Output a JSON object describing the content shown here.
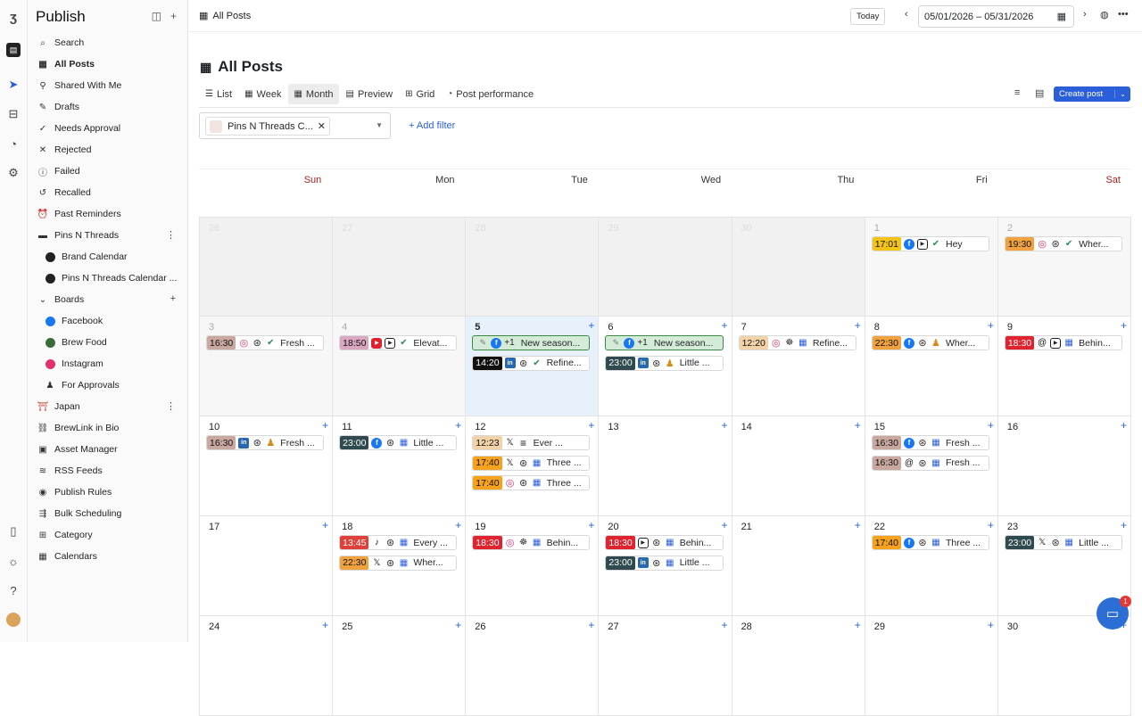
{
  "app": {
    "title": "Publish"
  },
  "crumb": "All Posts",
  "toolbar": {
    "today": "Today",
    "date_range": "05/01/2026  – 05/31/2026",
    "create_post": "Create post"
  },
  "page_title": "All Posts",
  "views": [
    {
      "label": "List"
    },
    {
      "label": "Week"
    },
    {
      "label": "Month"
    },
    {
      "label": "Preview"
    },
    {
      "label": "Grid"
    },
    {
      "label": "Post performance"
    }
  ],
  "filter": {
    "chip": "Pins N Threads C...",
    "add": "Add filter"
  },
  "nav": [
    {
      "label": "Search"
    },
    {
      "label": "All Posts"
    },
    {
      "label": "Shared With Me"
    },
    {
      "label": "Drafts"
    },
    {
      "label": "Needs Approval"
    },
    {
      "label": "Rejected"
    },
    {
      "label": "Failed"
    },
    {
      "label": "Recalled"
    },
    {
      "label": "Past Reminders"
    },
    {
      "label": "Pins N Threads"
    },
    {
      "label": "Brand Calendar"
    },
    {
      "label": "Pins N Threads Calendar ..."
    },
    {
      "label": "Boards"
    },
    {
      "label": "Facebook"
    },
    {
      "label": "Brew Food"
    },
    {
      "label": "Instagram"
    },
    {
      "label": "For Approvals"
    },
    {
      "label": "Japan"
    },
    {
      "label": "BrewLink in Bio"
    },
    {
      "label": "Asset Manager"
    },
    {
      "label": "RSS Feeds"
    },
    {
      "label": "Publish Rules"
    },
    {
      "label": "Bulk Scheduling"
    },
    {
      "label": "Category"
    },
    {
      "label": "Calendars"
    }
  ],
  "days": [
    "Sun",
    "Mon",
    "Tue",
    "Wed",
    "Thu",
    "Fri",
    "Sat"
  ],
  "weeks": [
    [
      {
        "d": "26",
        "out": true
      },
      {
        "d": "27",
        "out": true
      },
      {
        "d": "28",
        "out": true
      },
      {
        "d": "29",
        "out": true
      },
      {
        "d": "30",
        "out": true
      },
      {
        "d": "1",
        "dim": true
      },
      {
        "d": "2",
        "dim": true
      }
    ],
    [
      {
        "d": "3",
        "dim": true
      },
      {
        "d": "4",
        "dim": true
      },
      {
        "d": "5",
        "today": true
      },
      {
        "d": "6"
      },
      {
        "d": "7"
      },
      {
        "d": "8"
      },
      {
        "d": "9"
      }
    ],
    [
      {
        "d": "10"
      },
      {
        "d": "11"
      },
      {
        "d": "12"
      },
      {
        "d": "13"
      },
      {
        "d": "14"
      },
      {
        "d": "15"
      },
      {
        "d": "16"
      }
    ],
    [
      {
        "d": "17"
      },
      {
        "d": "18"
      },
      {
        "d": "19"
      },
      {
        "d": "20"
      },
      {
        "d": "21"
      },
      {
        "d": "22"
      },
      {
        "d": "23"
      }
    ],
    [
      {
        "d": "24"
      },
      {
        "d": "25"
      },
      {
        "d": "26"
      },
      {
        "d": "27"
      },
      {
        "d": "28"
      },
      {
        "d": "29"
      },
      {
        "d": "30"
      }
    ]
  ],
  "posts": {
    "w0_d5": [
      {
        "time": "17:01",
        "text": "Hey"
      }
    ],
    "w0_d6": [
      {
        "time": "19:30",
        "text": "Wher..."
      }
    ],
    "w1_d0": [
      {
        "time": "16:30",
        "text": "Fresh ..."
      }
    ],
    "w1_d1": [
      {
        "time": "18:50",
        "text": "Elevat..."
      }
    ],
    "w1_d2": [
      {
        "extra": "+1",
        "text": "New season..."
      },
      {
        "time": "14:20",
        "text": "Refine..."
      }
    ],
    "w1_d3": [
      {
        "extra": "+1",
        "text": "New season..."
      },
      {
        "time": "23:00",
        "text": "Little ..."
      }
    ],
    "w1_d4": [
      {
        "time": "12:20",
        "text": "Refine..."
      }
    ],
    "w1_d5": [
      {
        "time": "22:30",
        "text": "Wher..."
      }
    ],
    "w1_d6": [
      {
        "time": "18:30",
        "text": "Behin..."
      }
    ],
    "w2_d0": [
      {
        "time": "16:30",
        "text": "Fresh ..."
      }
    ],
    "w2_d1": [
      {
        "time": "23:00",
        "text": "Little ..."
      }
    ],
    "w2_d2": [
      {
        "time": "12:23",
        "text": "Ever ..."
      },
      {
        "time": "17:40",
        "text": "Three ..."
      },
      {
        "time": "17:40",
        "text": "Three ..."
      }
    ],
    "w2_d5": [
      {
        "time": "16:30",
        "text": "Fresh ..."
      },
      {
        "time": "16:30",
        "text": "Fresh ..."
      }
    ],
    "w3_d1": [
      {
        "time": "13:45",
        "text": "Every ..."
      },
      {
        "time": "22:30",
        "text": "Wher..."
      }
    ],
    "w3_d2": [
      {
        "time": "18:30",
        "text": "Behin..."
      }
    ],
    "w3_d3": [
      {
        "time": "18:30",
        "text": "Behin..."
      },
      {
        "time": "23:00",
        "text": "Little ..."
      }
    ],
    "w3_d5": [
      {
        "time": "17:40",
        "text": "Three ..."
      }
    ],
    "w3_d6": [
      {
        "time": "23:00",
        "text": "Little ..."
      }
    ]
  },
  "help_badge": "1",
  "colors": {
    "accent": "#2b5fd9",
    "today_bg": "#e7f1fc",
    "weekend": "#b02020"
  }
}
